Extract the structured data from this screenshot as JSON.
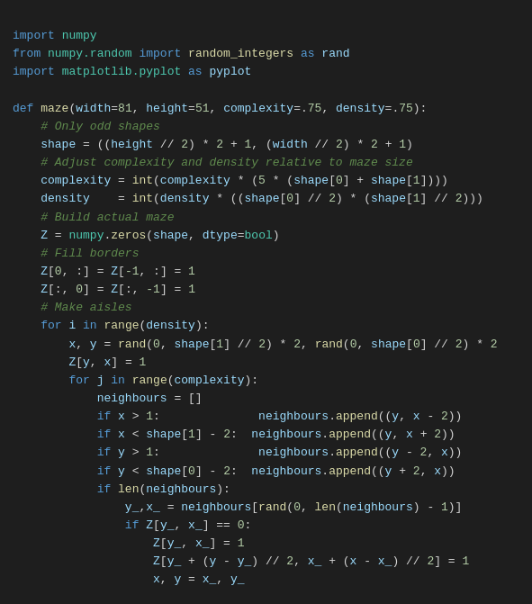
{
  "code": {
    "lines": []
  },
  "colors": {
    "background": "#1e1e1e",
    "keyword": "#569cd6",
    "function": "#dcdcaa",
    "comment": "#608b4e",
    "string": "#ce9178",
    "number": "#b5cea8",
    "variable": "#9cdcfe",
    "module": "#4ec9b0",
    "plain": "#d4d4d4"
  }
}
